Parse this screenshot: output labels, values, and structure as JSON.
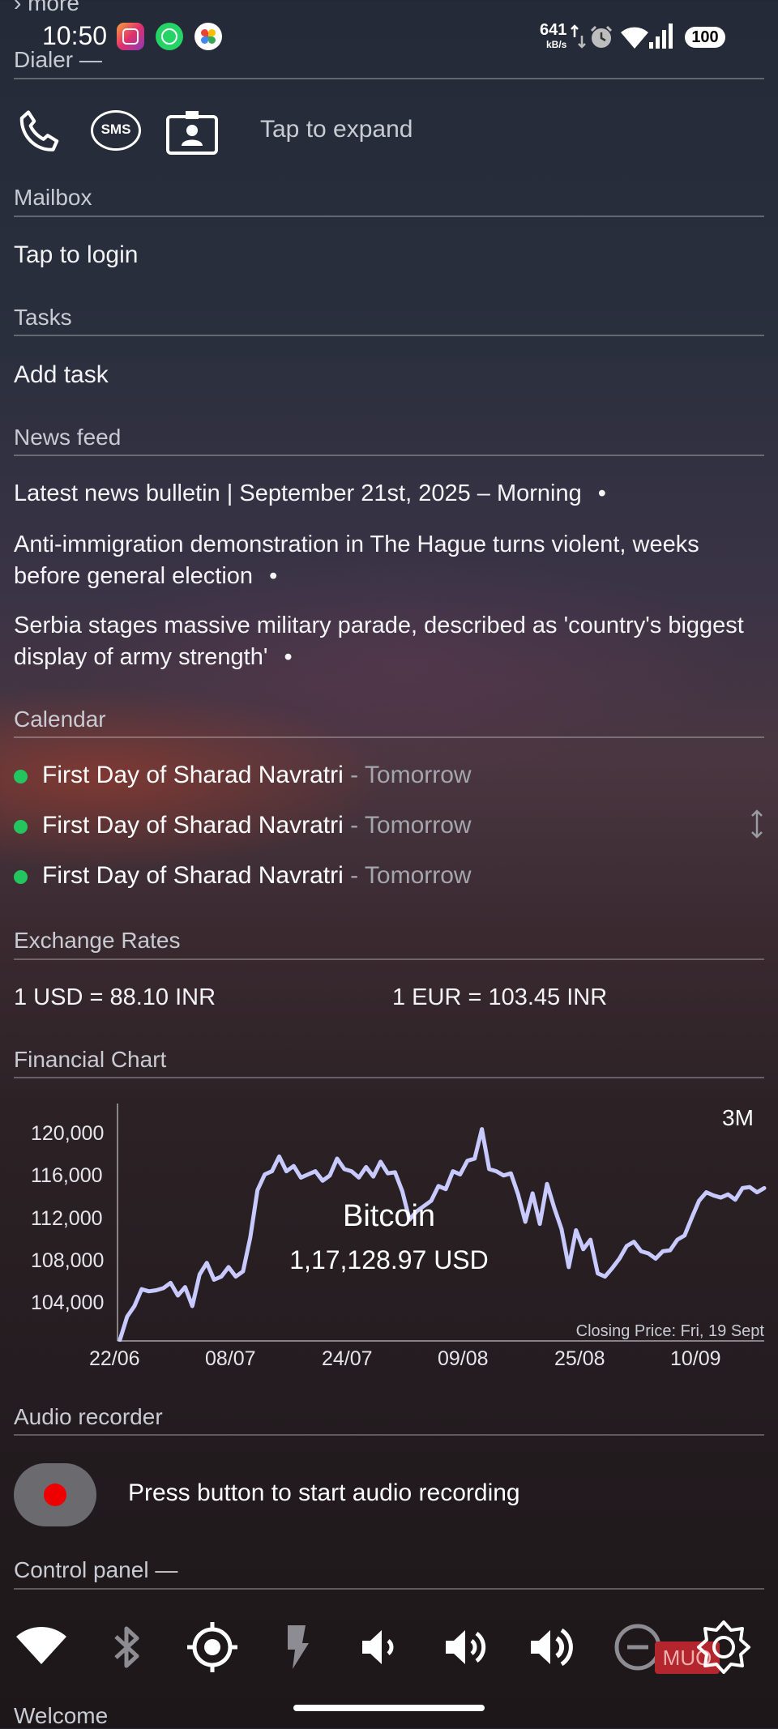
{
  "status_bar": {
    "partial_top_label": "› more",
    "time": "10:50",
    "net_speed_value": "641",
    "net_speed_unit": "kB/s",
    "battery": "100"
  },
  "dialer": {
    "header": "Dialer —",
    "tap_to_expand": "Tap to expand",
    "sms_label": "SMS",
    "icons": [
      "phone-icon",
      "sms-icon",
      "contacts-icon"
    ]
  },
  "mailbox": {
    "header": "Mailbox",
    "action": "Tap to login"
  },
  "tasks": {
    "header": "Tasks",
    "action": "Add task"
  },
  "news_feed": {
    "header": "News feed",
    "items": [
      "Latest news bulletin | September 21st, 2025 – Morning",
      "Anti-immigration demonstration in The Hague turns violent, weeks before general election",
      "Serbia stages massive military parade, described as 'country's biggest display of army strength'"
    ],
    "bullet": "•"
  },
  "calendar": {
    "header": "Calendar",
    "events": [
      {
        "title": "First Day of Sharad Navratri",
        "when": " - Tomorrow"
      },
      {
        "title": "First Day of Sharad Navratri",
        "when": " - Tomorrow"
      },
      {
        "title": "First Day of Sharad Navratri",
        "when": " - Tomorrow"
      }
    ],
    "dot_color": "#22c55e"
  },
  "exchange_rates": {
    "header": "Exchange Rates",
    "usd": "1 USD = 88.10 INR",
    "eur": "1 EUR = 103.45 INR"
  },
  "financial_chart": {
    "header": "Financial Chart",
    "range_label": "3M",
    "asset": "Bitcoin",
    "price": "1,17,128.97 USD",
    "footnote": "Closing Price: Fri, 19 Sept"
  },
  "chart_data": {
    "type": "line",
    "title": "Bitcoin",
    "xlabel": "",
    "ylabel": "",
    "x_ticks": [
      "22/06",
      "08/07",
      "24/07",
      "09/08",
      "25/08",
      "10/09"
    ],
    "y_ticks": [
      "120,000",
      "116,000",
      "112,000",
      "108,000",
      "104,000"
    ],
    "ylim": [
      101500,
      122500
    ],
    "grid": false,
    "series": [
      {
        "color": "#c7c9ff",
        "x": [
          "22/06",
          "23/06",
          "24/06",
          "25/06",
          "26/06",
          "27/06",
          "28/06",
          "29/06",
          "30/06",
          "01/07",
          "02/07",
          "03/07",
          "04/07",
          "05/07",
          "06/07",
          "07/07",
          "08/07",
          "09/07",
          "10/07",
          "11/07",
          "12/07",
          "13/07",
          "14/07",
          "15/07",
          "16/07",
          "17/07",
          "18/07",
          "19/07",
          "20/07",
          "21/07",
          "22/07",
          "23/07",
          "24/07",
          "25/07",
          "26/07",
          "27/07",
          "28/07",
          "29/07",
          "30/07",
          "31/07",
          "01/08",
          "02/08",
          "03/08",
          "04/08",
          "05/08",
          "06/08",
          "07/08",
          "08/08",
          "09/08",
          "10/08",
          "11/08",
          "12/08",
          "13/08",
          "14/08",
          "15/08",
          "16/08",
          "17/08",
          "18/08",
          "19/08",
          "20/08",
          "21/08",
          "22/08",
          "23/08",
          "24/08",
          "25/08",
          "26/08",
          "27/08",
          "28/08",
          "29/08",
          "30/08",
          "31/08",
          "01/09",
          "02/09",
          "03/09",
          "04/09",
          "05/09",
          "06/09",
          "07/09",
          "08/09",
          "09/09",
          "10/09",
          "11/09",
          "12/09",
          "13/09",
          "14/09",
          "15/09",
          "16/09",
          "17/09",
          "18/09",
          "19/09"
        ],
        "values": [
          101800,
          104000,
          105000,
          106600,
          106400,
          106500,
          106700,
          107200,
          106000,
          106800,
          105000,
          108000,
          109100,
          107500,
          107800,
          108700,
          107800,
          108300,
          111500,
          116000,
          117500,
          117800,
          119200,
          117800,
          118300,
          117200,
          117500,
          117800,
          116900,
          117400,
          119000,
          118000,
          117800,
          117200,
          118200,
          117300,
          118700,
          117600,
          117700,
          115900,
          113200,
          114000,
          114500,
          115000,
          116400,
          116100,
          117800,
          117500,
          118800,
          119000,
          121800,
          118000,
          117800,
          117400,
          117600,
          115600,
          113000,
          115700,
          112800,
          116600,
          114300,
          112300,
          108700,
          112200,
          110400,
          111300,
          108100,
          107800,
          108600,
          109500,
          110700,
          111100,
          110200,
          110000,
          109500,
          110200,
          110300,
          111300,
          111700,
          113400,
          115000,
          115800,
          115500,
          115300,
          115600,
          115100,
          116200,
          116300,
          115800,
          116200
        ]
      }
    ]
  },
  "audio_recorder": {
    "header": "Audio recorder",
    "prompt": "Press button to start audio recording"
  },
  "control_panel": {
    "header": "Control panel —",
    "icons": [
      "wifi-icon",
      "bluetooth-icon",
      "location-icon",
      "flashlight-icon",
      "volume-low-icon",
      "volume-medium-icon",
      "volume-high-icon",
      "do-not-disturb-icon",
      "brightness-icon"
    ]
  },
  "watermark": {
    "text": "MUO"
  },
  "welcome": {
    "header": "Welcome"
  }
}
